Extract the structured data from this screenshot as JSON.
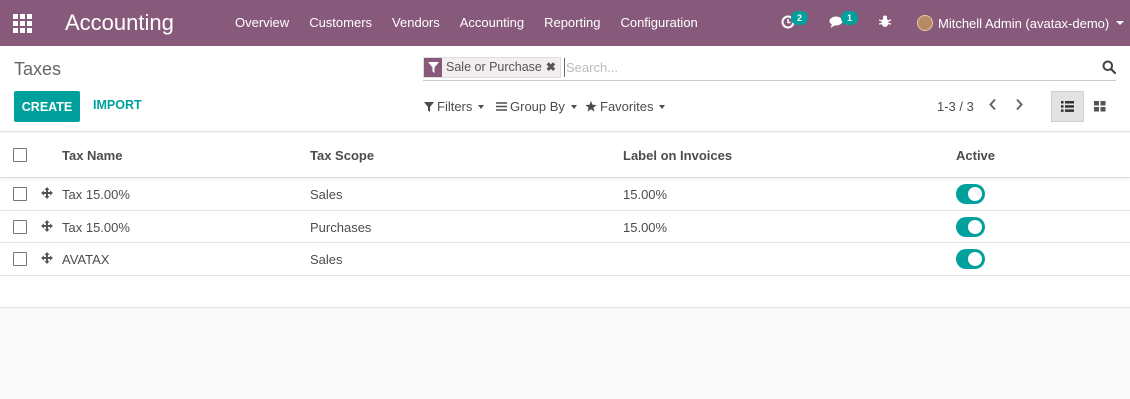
{
  "navbar": {
    "app_name": "Accounting",
    "menu": [
      "Overview",
      "Customers",
      "Vendors",
      "Accounting",
      "Reporting",
      "Configuration"
    ],
    "activity_count": "2",
    "messages_count": "1",
    "user": "Mitchell Admin (avatax-demo)",
    "color": "#875a7b"
  },
  "control_panel": {
    "breadcrumb": "Taxes",
    "facet_label": "Sale or Purchase",
    "facet_close": "✖",
    "search_placeholder": "Search...",
    "create_label": "CREATE",
    "import_label": "IMPORT",
    "filters_label": "Filters",
    "groupby_label": "Group By",
    "favorites_label": "Favorites",
    "pager": "1-3 / 3",
    "accent": "#00a09d"
  },
  "list": {
    "columns": [
      "Tax Name",
      "Tax Scope",
      "Label on Invoices",
      "Active"
    ],
    "rows": [
      {
        "name": "Tax 15.00%",
        "scope": "Sales",
        "label": "15.00%",
        "active": true
      },
      {
        "name": "Tax 15.00%",
        "scope": "Purchases",
        "label": "15.00%",
        "active": true
      },
      {
        "name": "AVATAX",
        "scope": "Sales",
        "label": "",
        "active": true
      }
    ]
  }
}
